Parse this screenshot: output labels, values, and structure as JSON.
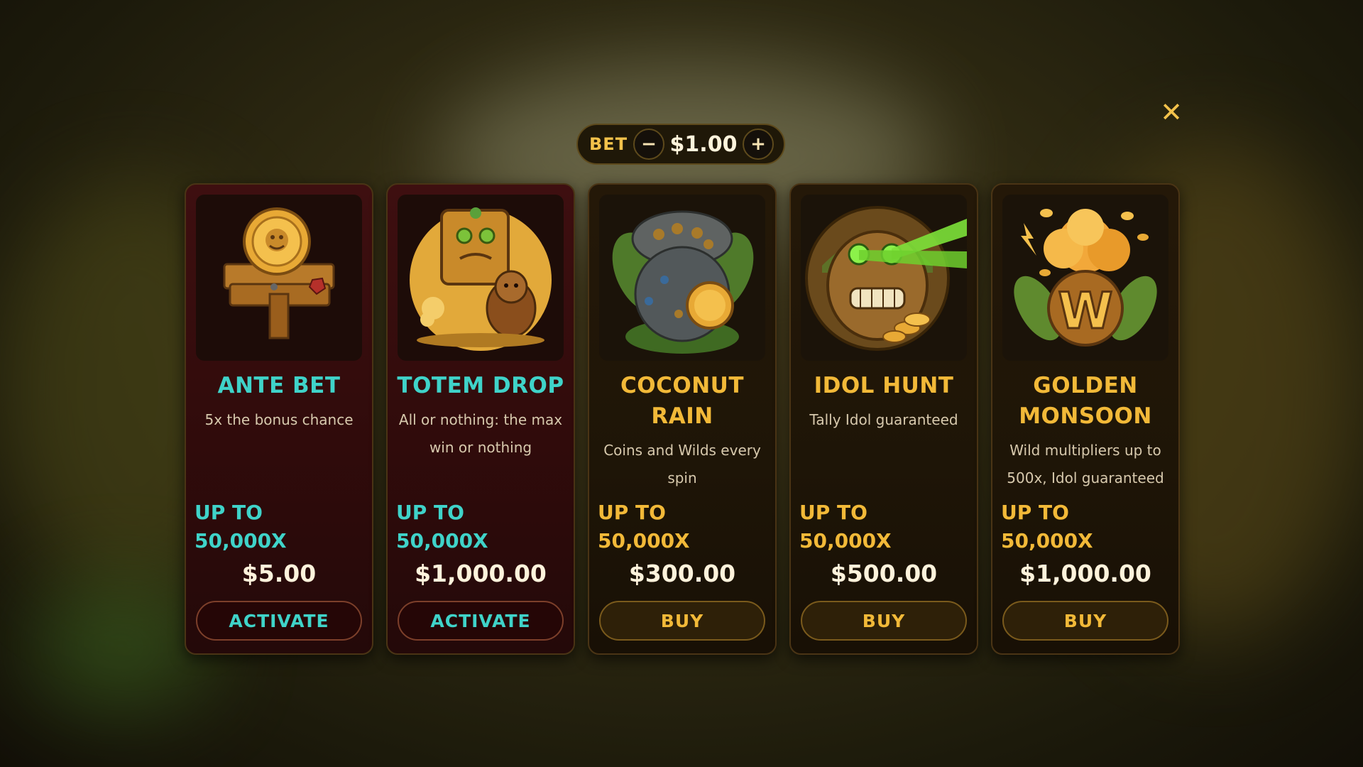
{
  "bet": {
    "label": "BET",
    "value": "$1.00",
    "minus": "−",
    "plus": "+"
  },
  "close_label": "✕",
  "colors": {
    "accent_gold": "#f2b938",
    "accent_cyan": "#3fd3c9",
    "card_maroon": "#3e0f10",
    "card_dark": "#241808"
  },
  "cards": [
    {
      "title": "ANTE BET",
      "description": "5x the bonus chance",
      "upto": "UP TO",
      "multiplier": "50,000X",
      "price": "$5.00",
      "action": "ACTIVATE",
      "icon": "ante-bet-coin-sign-icon"
    },
    {
      "title": "TOTEM DROP",
      "description": "All or nothing: the max win or nothing",
      "upto": "UP TO",
      "multiplier": "50,000X",
      "price": "$1,000.00",
      "action": "ACTIVATE",
      "icon": "totem-monkey-icon"
    },
    {
      "title_line1": "COCONUT",
      "title_line2": "RAIN",
      "description": "Coins and Wilds every spin",
      "upto": "UP TO",
      "multiplier": "50,000X",
      "price": "$300.00",
      "action": "BUY",
      "icon": "coconut-rain-cloud-icon"
    },
    {
      "title": "IDOL HUNT",
      "description": "Tally Idol guaranteed",
      "upto": "UP TO",
      "multiplier": "50,000X",
      "price": "$500.00",
      "action": "BUY",
      "icon": "idol-laser-eyes-icon"
    },
    {
      "title_line1": "GOLDEN",
      "title_line2": "MONSOON",
      "description": "Wild multipliers up to 500x, Idol guaranteed",
      "upto": "UP TO",
      "multiplier": "50,000X",
      "price": "$1,000.00",
      "action": "BUY",
      "icon": "golden-monsoon-wild-icon"
    }
  ]
}
